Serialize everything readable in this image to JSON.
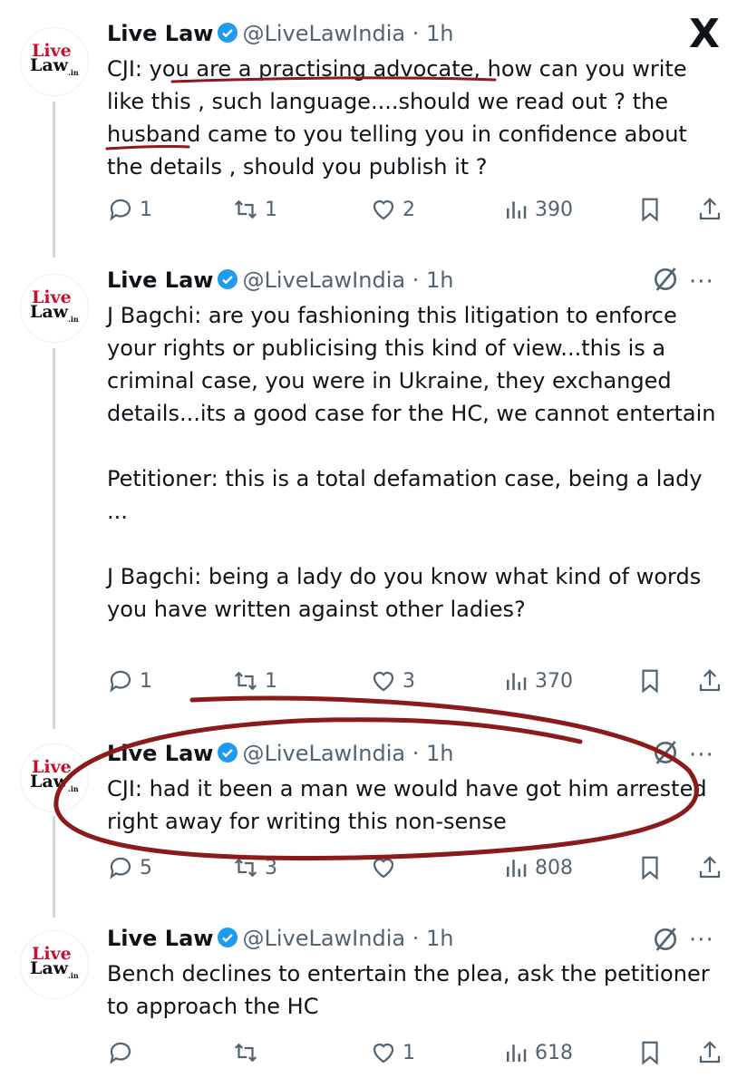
{
  "brand": {
    "logo_line1": "Live",
    "logo_line2": "Law",
    "logo_suffix": ".in",
    "x_logo": "X"
  },
  "colors": {
    "accent_red": "#c8102e",
    "verified": "#1d9bf0",
    "muted": "#536471",
    "annotation": "#8b1a1a"
  },
  "tweets": [
    {
      "name": "Live Law",
      "handle": "@LiveLawIndia",
      "dot": "·",
      "time": "1h",
      "text": "CJI: you are a practising advocate, how can you write like this , such language....should we read out ? the husband came to you telling you in confidence about the details , should you publish it ?",
      "replies": "1",
      "reposts": "1",
      "likes": "2",
      "views": "390"
    },
    {
      "name": "Live Law",
      "handle": "@LiveLawIndia",
      "dot": "·",
      "time": "1h",
      "text": "J Bagchi: are you fashioning this litigation to enforce your rights or publicising this kind of view...this is a criminal case, you were in Ukraine, they exchanged details...its a good case for the HC, we cannot entertain\n\nPetitioner: this is a total defamation case, being a lady ...\n\nJ Bagchi: being a lady do you know what kind of words you have written against other ladies?",
      "replies": "1",
      "reposts": "1",
      "likes": "3",
      "views": "370"
    },
    {
      "name": "Live Law",
      "handle": "@LiveLawIndia",
      "dot": "·",
      "time": "1h",
      "text": "CJI: had it been a man we would have got him arrested right away for writing this non-sense",
      "replies": "5",
      "reposts": "3",
      "likes": "",
      "views": "808"
    },
    {
      "name": "Live Law",
      "handle": "@LiveLawIndia",
      "dot": "·",
      "time": "1h",
      "text": "Bench declines to entertain the plea, ask the petitioner to approach the HC",
      "replies": "",
      "reposts": "",
      "likes": "1",
      "views": "618"
    }
  ],
  "icons": {
    "more": "···",
    "grok": "grok-slash-icon"
  }
}
